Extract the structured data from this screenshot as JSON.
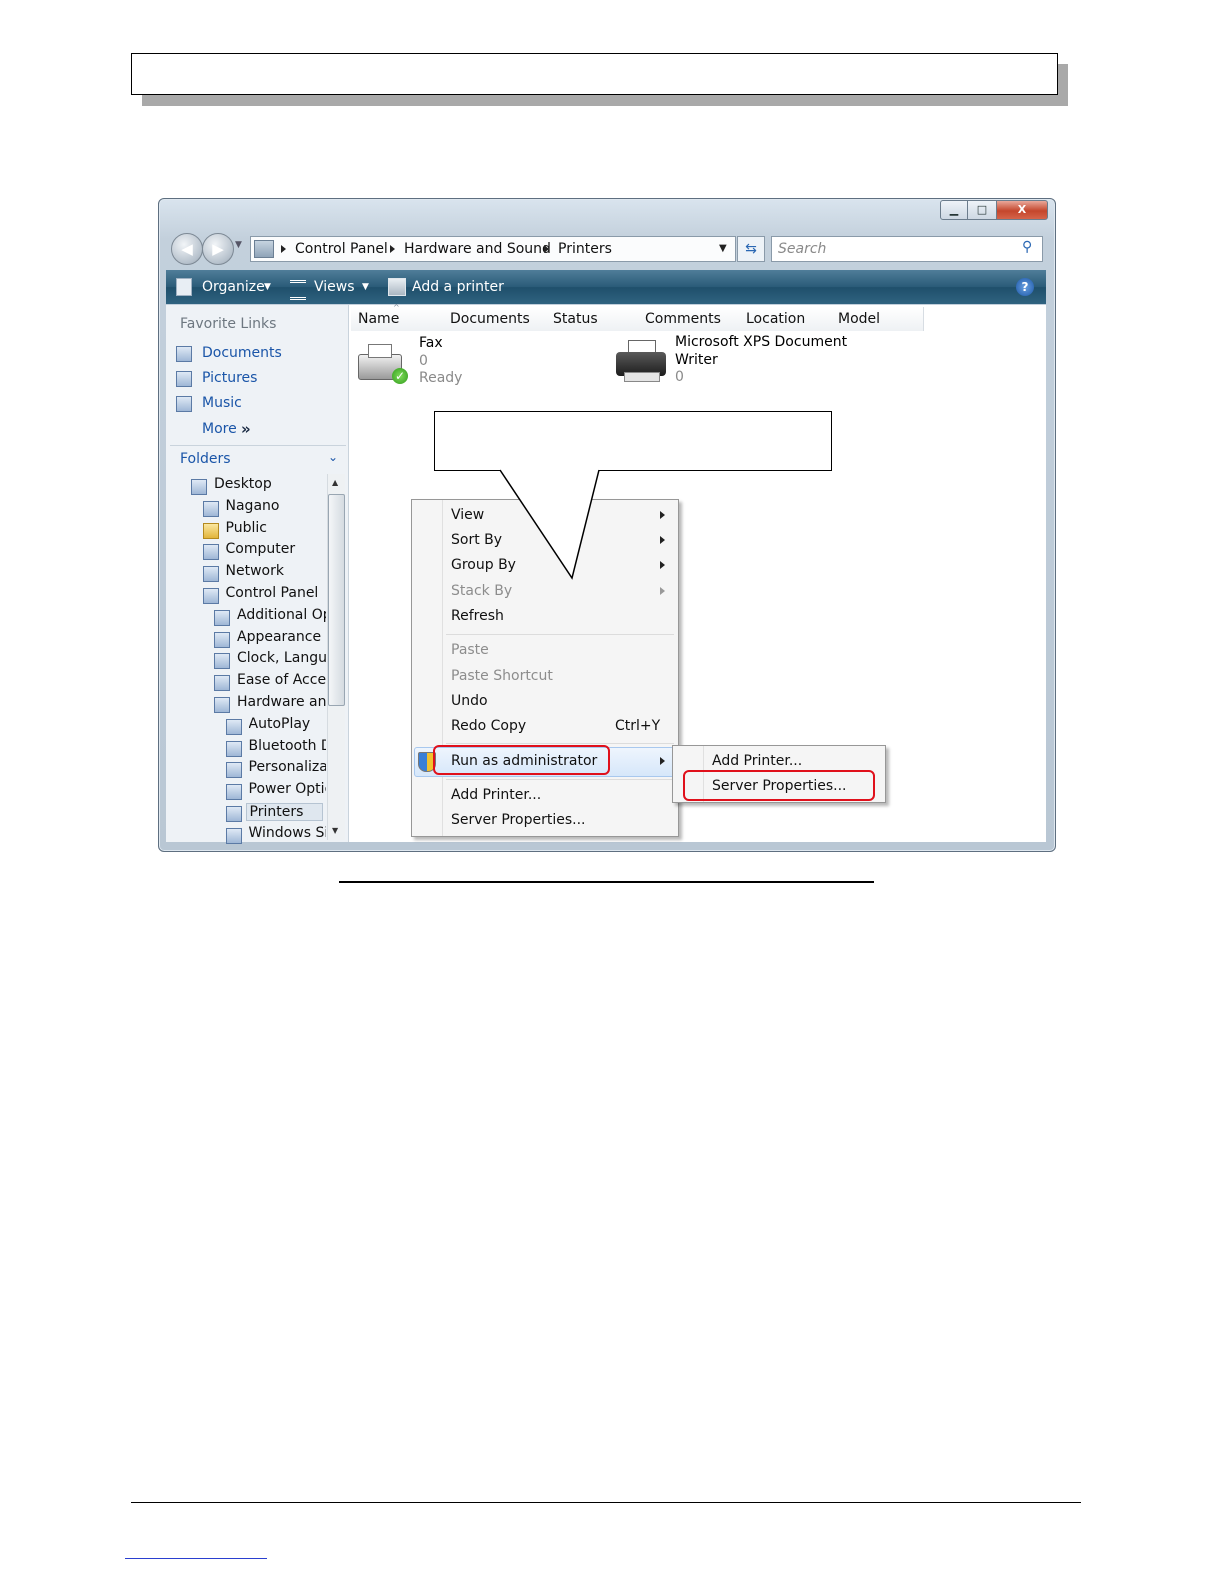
{
  "window": {
    "controls": {
      "minimize": "▁",
      "maximize": "□",
      "close": "X"
    }
  },
  "address": {
    "items": [
      "Control Panel",
      "Hardware and Sound",
      "Printers"
    ]
  },
  "search": {
    "placeholder": "Search"
  },
  "toolbar": {
    "organize": "Organize",
    "views": "Views",
    "add_printer": "Add a printer",
    "help": "?"
  },
  "favorites": {
    "heading": "Favorite Links",
    "items": [
      "Documents",
      "Pictures",
      "Music"
    ],
    "more": "More",
    "more_glyph": "»"
  },
  "folders": {
    "heading": "Folders",
    "tree": [
      "Desktop",
      "Nagano",
      "Public",
      "Computer",
      "Network",
      "Control Panel",
      "Additional Opt",
      "Appearance ar",
      "Clock, Langua",
      "Ease of Access",
      "Hardware and",
      "AutoPlay",
      "Bluetooth De",
      "Personalizati",
      "Power Optio",
      "Printers",
      "Windows Sid"
    ]
  },
  "columns": [
    "Name",
    "Documents",
    "Status",
    "Comments",
    "Location",
    "Model"
  ],
  "printers": [
    {
      "name": "Fax",
      "docs": "0",
      "status": "Ready"
    },
    {
      "name": "Microsoft XPS Document",
      "name2": "Writer",
      "docs": "0"
    }
  ],
  "context_menu": {
    "view": "View",
    "sort_by": "Sort By",
    "group_by": "Group By",
    "stack_by": "Stack By",
    "refresh": "Refresh",
    "paste": "Paste",
    "paste_shortcut": "Paste Shortcut",
    "undo": "Undo",
    "redo_copy": "Redo Copy",
    "redo_shortcut": "Ctrl+Y",
    "run_as_admin": "Run as administrator",
    "add_printer": "Add Printer...",
    "server_properties": "Server Properties..."
  },
  "submenu": {
    "add_printer": "Add Printer...",
    "server_properties": "Server Properties..."
  }
}
